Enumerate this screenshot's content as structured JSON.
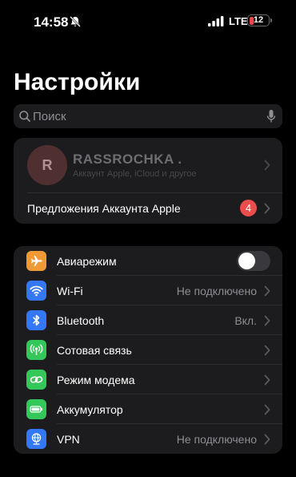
{
  "status_bar": {
    "time": "14:58",
    "network": "LTE",
    "battery": "12"
  },
  "title": "Настройки",
  "search": {
    "placeholder": "Поиск"
  },
  "account": {
    "avatar_initial": "R",
    "name": "RASSROCHKA .",
    "subtitle": "Аккаунт Apple, iCloud и другое",
    "offers_label": "Предложения Аккаунта Apple",
    "offers_badge": "4"
  },
  "settings": {
    "airplane": {
      "label": "Авиарежим",
      "on": false,
      "color": "#f09a37"
    },
    "wifi": {
      "label": "Wi-Fi",
      "value": "Не подключено",
      "color": "#3478f6"
    },
    "bluetooth": {
      "label": "Bluetooth",
      "value": "Вкл.",
      "color": "#3478f6"
    },
    "cellular": {
      "label": "Сотовая связь",
      "color": "#34c759"
    },
    "hotspot": {
      "label": "Режим модема",
      "color": "#34c759"
    },
    "battery": {
      "label": "Аккумулятор",
      "color": "#34c759"
    },
    "vpn": {
      "label": "VPN",
      "value": "Не подключено",
      "color": "#3478f6"
    }
  }
}
